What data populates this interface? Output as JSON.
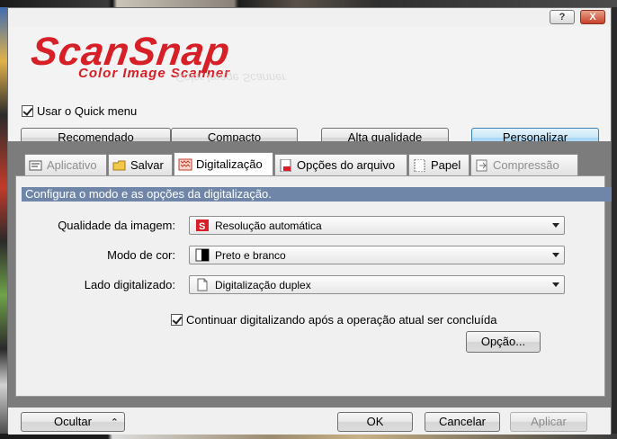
{
  "window": {
    "help_label": "?",
    "close_label": "X"
  },
  "header": {
    "brand": "ScanSnap",
    "tagline": "Color Image Scanner",
    "quick_menu_label": "Usar o Quick menu",
    "quick_menu_checked": true
  },
  "presets": [
    {
      "label": "Recomendado"
    },
    {
      "label": "Compacto"
    },
    {
      "label": "Alta qualidade"
    },
    {
      "label": "Personalizar"
    }
  ],
  "tabs": [
    {
      "label": "Aplicativo",
      "icon": "application-icon",
      "enabled": false
    },
    {
      "label": "Salvar",
      "icon": "folder-icon",
      "enabled": true
    },
    {
      "label": "Digitalização",
      "icon": "scan-pattern-icon",
      "enabled": true,
      "selected": true
    },
    {
      "label": "Opções do arquivo",
      "icon": "pdf-file-icon",
      "enabled": true
    },
    {
      "label": "Papel",
      "icon": "paper-icon",
      "enabled": true
    },
    {
      "label": "Compressão",
      "icon": "compression-icon",
      "enabled": false
    }
  ],
  "panel": {
    "description": "Configura o modo e as opções da digitalização.",
    "image_quality_label": "Qualidade da imagem:",
    "image_quality_value": "Resolução automática",
    "color_mode_label": "Modo de cor:",
    "color_mode_value": "Preto e branco",
    "scan_side_label": "Lado digitalizado:",
    "scan_side_value": "Digitalização duplex",
    "continue_label": "Continuar digitalizando após a operação atual ser concluída",
    "continue_checked": true,
    "option_label": "Opção..."
  },
  "footer": {
    "hide_label": "Ocultar",
    "ok_label": "OK",
    "cancel_label": "Cancelar",
    "apply_label": "Aplicar"
  },
  "colors": {
    "brand_red": "#d61f26",
    "panel_header": "#6f86a8",
    "active_preset": "#b6def7"
  }
}
